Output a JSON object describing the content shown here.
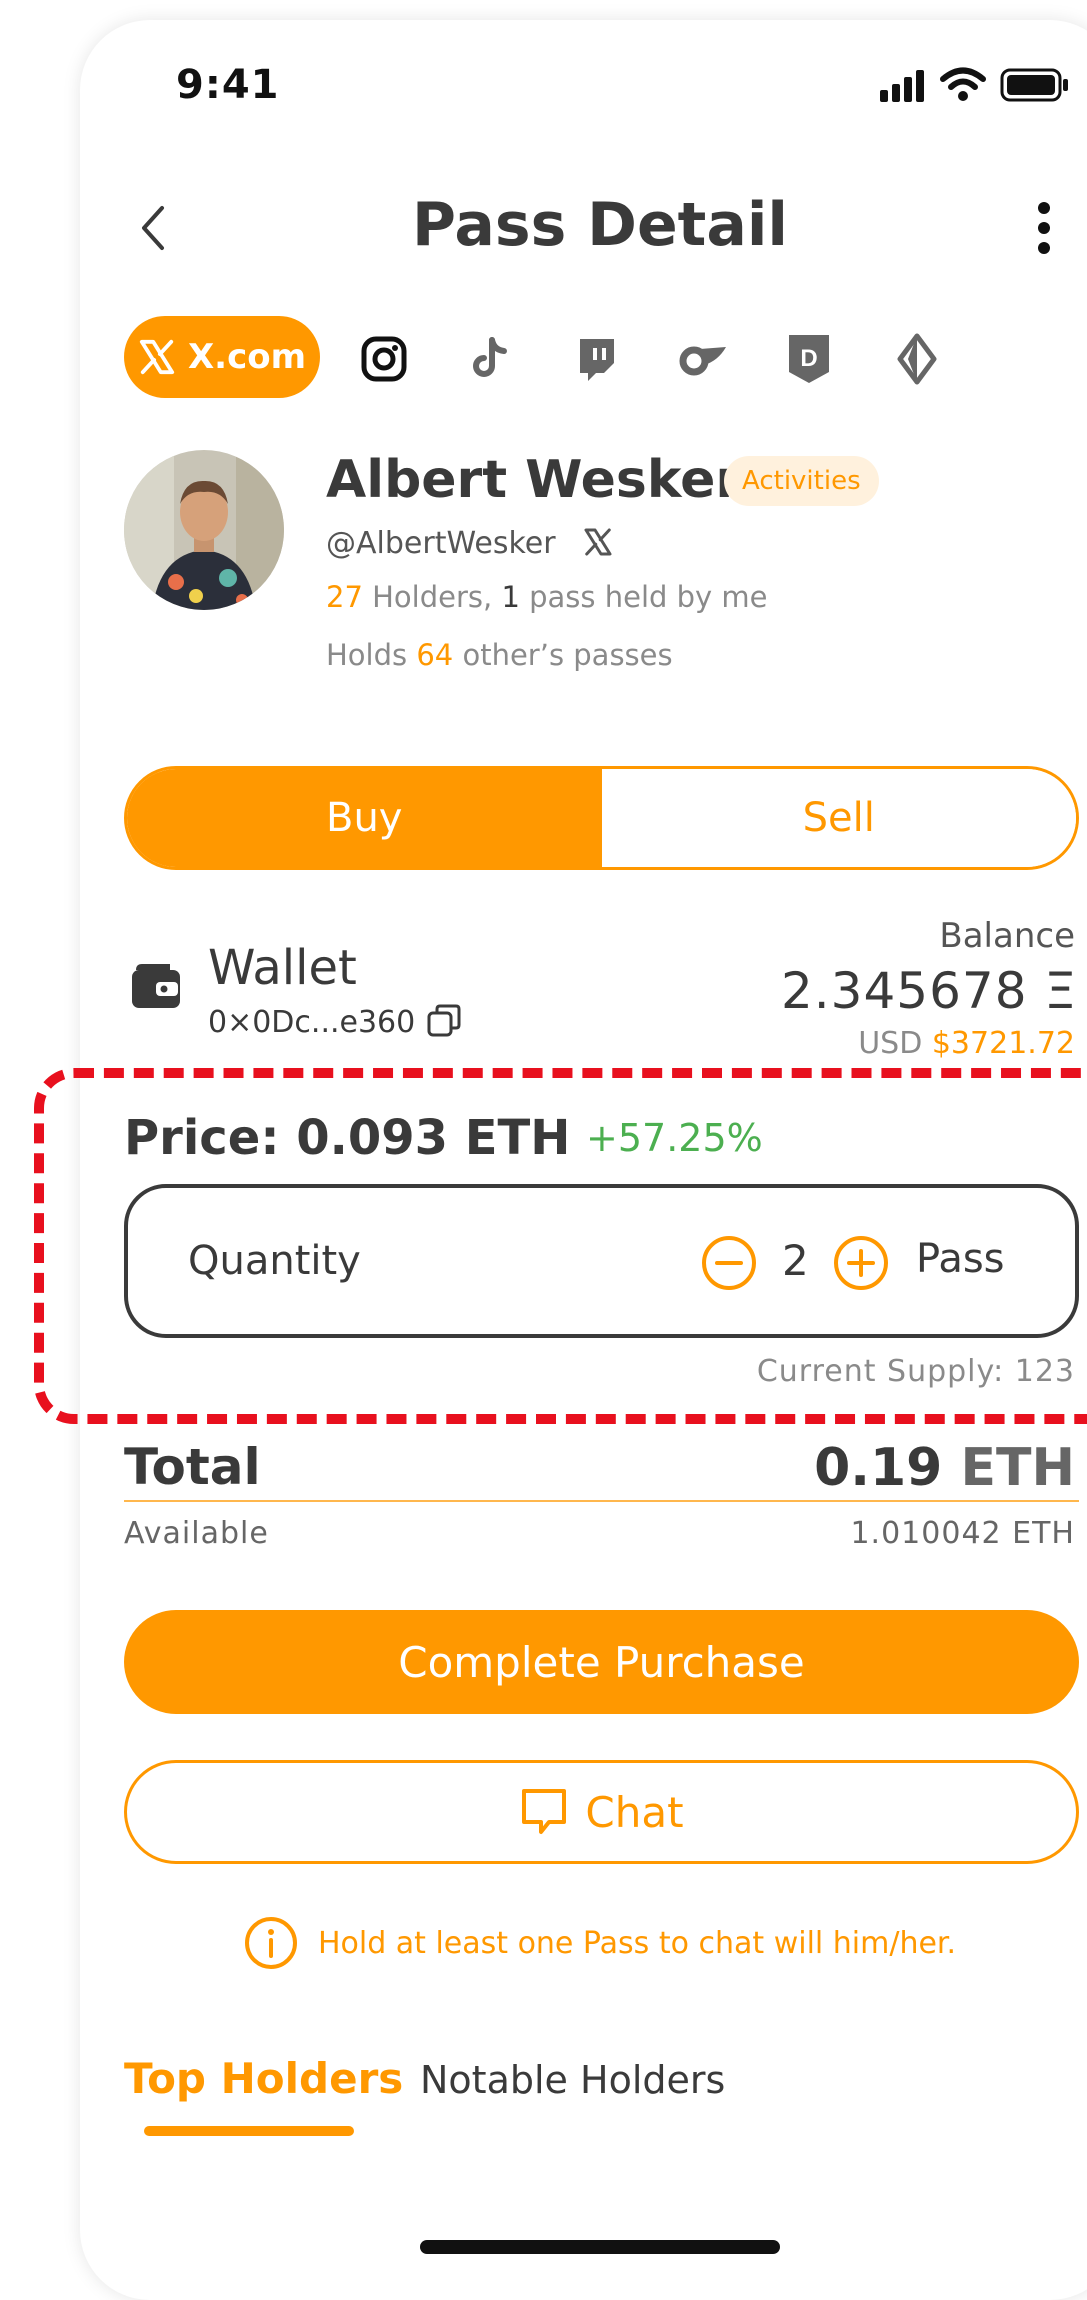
{
  "status_bar": {
    "time": "9:41"
  },
  "header": {
    "title": "Pass Detail"
  },
  "platforms": {
    "active": "X.com",
    "icons": [
      "x-icon",
      "instagram-icon",
      "tiktok-icon",
      "twitch-icon",
      "onlyfans-icon",
      "d-icon",
      "ens-icon"
    ]
  },
  "profile": {
    "name": "Albert Wesker",
    "badge": "Activities",
    "handle": "@AlbertWesker",
    "holders_count": "27",
    "holders_text": " Holders, ",
    "held_count": "1",
    "held_text": " pass held by me",
    "holds_prefix": "Holds ",
    "holds_count": "64",
    "holds_suffix": " other’s passes"
  },
  "trade": {
    "buy_label": "Buy",
    "sell_label": "Sell",
    "selected": "Buy"
  },
  "wallet": {
    "label": "Wallet",
    "address": "0×0Dc...e360",
    "balance_label": "Balance",
    "balance_value": "2.345678 Ξ",
    "usd_label": "USD",
    "usd_value": "$3721.72"
  },
  "price": {
    "label": "Price: 0.093 ETH",
    "change": "+57.25%"
  },
  "quantity": {
    "label": "Quantity",
    "value": "2",
    "unit": "Pass"
  },
  "supply": {
    "text": "Current Supply: 123"
  },
  "total": {
    "label": "Total",
    "amount": "0.19",
    "unit": "ETH",
    "available_label": "Available",
    "available_value": "1.010042 ETH"
  },
  "actions": {
    "purchase_label": "Complete Purchase",
    "chat_label": "Chat",
    "hint": "Hold at least one Pass to chat will him/her."
  },
  "holder_tabs": {
    "top": "Top Holders",
    "notable": "Notable Holders"
  },
  "colors": {
    "accent": "#FF9800",
    "positive": "#4CAF50",
    "highlight": "#E8101E"
  }
}
